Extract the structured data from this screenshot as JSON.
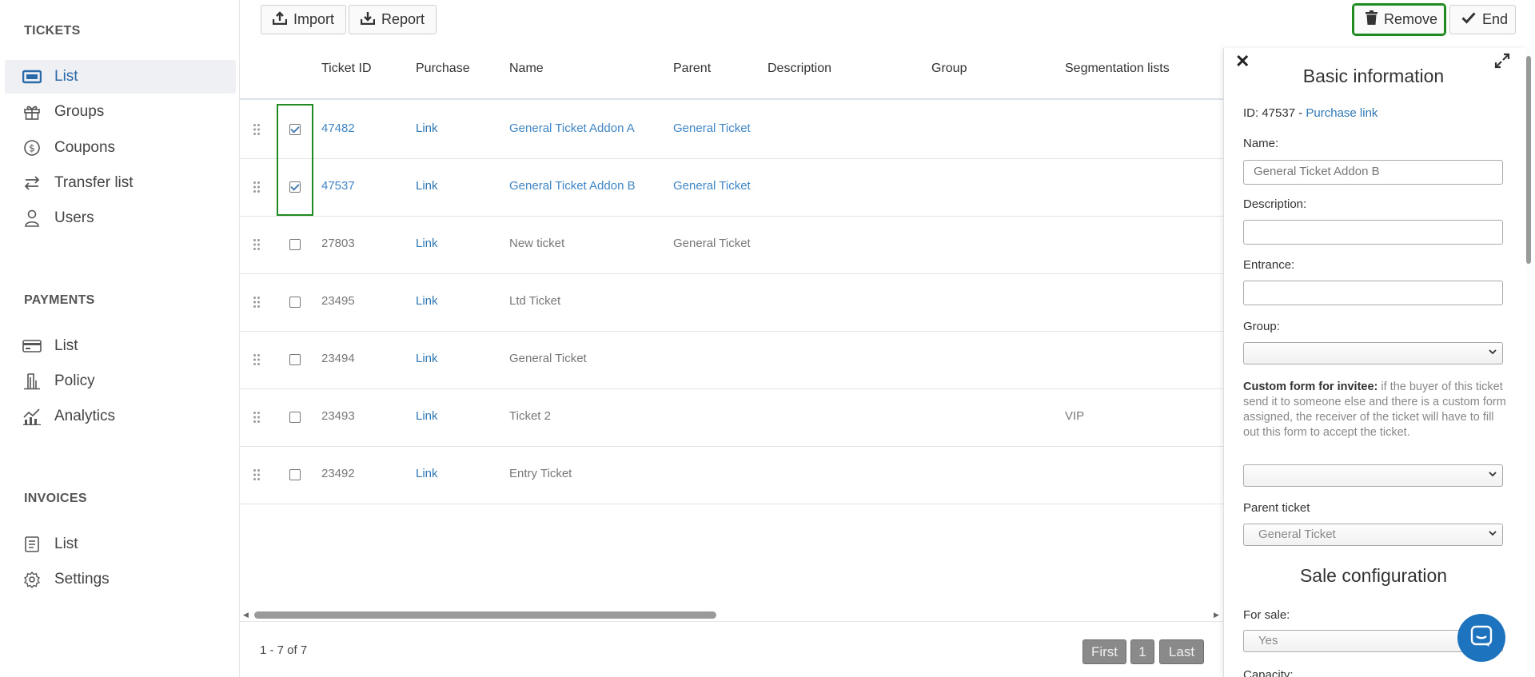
{
  "sidebar": {
    "sections": [
      {
        "title": "TICKETS",
        "items": [
          {
            "label": "List",
            "icon": "ticket-icon",
            "active": true
          },
          {
            "label": "Groups",
            "icon": "gift-icon"
          },
          {
            "label": "Coupons",
            "icon": "coin-icon"
          },
          {
            "label": "Transfer list",
            "icon": "transfer-icon"
          },
          {
            "label": "Users",
            "icon": "user-icon"
          }
        ]
      },
      {
        "title": "PAYMENTS",
        "items": [
          {
            "label": "List",
            "icon": "card-icon"
          },
          {
            "label": "Policy",
            "icon": "bank-icon"
          },
          {
            "label": "Analytics",
            "icon": "analytics-icon"
          }
        ]
      },
      {
        "title": "INVOICES",
        "items": [
          {
            "label": "List",
            "icon": "document-icon"
          },
          {
            "label": "Settings",
            "icon": "gear-icon"
          }
        ]
      }
    ]
  },
  "toolbar": {
    "import_label": "Import",
    "report_label": "Report",
    "remove_label": "Remove",
    "end_label": "End"
  },
  "table": {
    "columns": [
      "Ticket ID",
      "Purchase",
      "Name",
      "Parent",
      "Description",
      "Group",
      "Segmentation lists"
    ],
    "rows": [
      {
        "id": "47482",
        "purchase": "Link",
        "name": "General Ticket Addon A",
        "parent": "General Ticket",
        "description": "",
        "group": "",
        "segmentation": "",
        "checked": true
      },
      {
        "id": "47537",
        "purchase": "Link",
        "name": "General Ticket Addon B",
        "parent": "General Ticket",
        "description": "",
        "group": "",
        "segmentation": "",
        "checked": true
      },
      {
        "id": "27803",
        "purchase": "Link",
        "name": "New ticket",
        "parent": "General Ticket",
        "description": "",
        "group": "",
        "segmentation": "",
        "checked": false
      },
      {
        "id": "23495",
        "purchase": "Link",
        "name": "Ltd Ticket",
        "parent": "",
        "description": "",
        "group": "",
        "segmentation": "",
        "checked": false
      },
      {
        "id": "23494",
        "purchase": "Link",
        "name": "General Ticket",
        "parent": "",
        "description": "",
        "group": "",
        "segmentation": "",
        "checked": false
      },
      {
        "id": "23493",
        "purchase": "Link",
        "name": "Ticket 2",
        "parent": "",
        "description": "",
        "group": "",
        "segmentation": "VIP",
        "checked": false
      },
      {
        "id": "23492",
        "purchase": "Link",
        "name": "Entry Ticket",
        "parent": "",
        "description": "",
        "group": "",
        "segmentation": "",
        "checked": false
      }
    ]
  },
  "pagination": {
    "range": "1 - 7 of 7",
    "first": "First",
    "page": "1",
    "last": "Last"
  },
  "panel": {
    "title": "Basic information",
    "id_prefix": "ID: 47537 - ",
    "purchase_link": "Purchase link",
    "name_label": "Name:",
    "name_value": "General Ticket Addon B",
    "description_label": "Description:",
    "description_value": "",
    "entrance_label": "Entrance:",
    "entrance_value": "",
    "group_label": "Group:",
    "group_value": "",
    "custom_form_label": "Custom form for invitee:",
    "custom_form_help": " if the buyer of this ticket send it to someone else and there is a custom form assigned, the receiver of the ticket will have to fill out this form to accept the ticket.",
    "custom_form_value": "",
    "parent_label": "Parent ticket",
    "parent_value": "General Ticket",
    "sale_title": "Sale configuration",
    "for_sale_label": "For sale:",
    "for_sale_value": "Yes",
    "capacity_label": "Capacity:"
  },
  "colors": {
    "accent": "#2f78b5",
    "highlight": "#1f8a1f",
    "chat": "#1e73be"
  }
}
